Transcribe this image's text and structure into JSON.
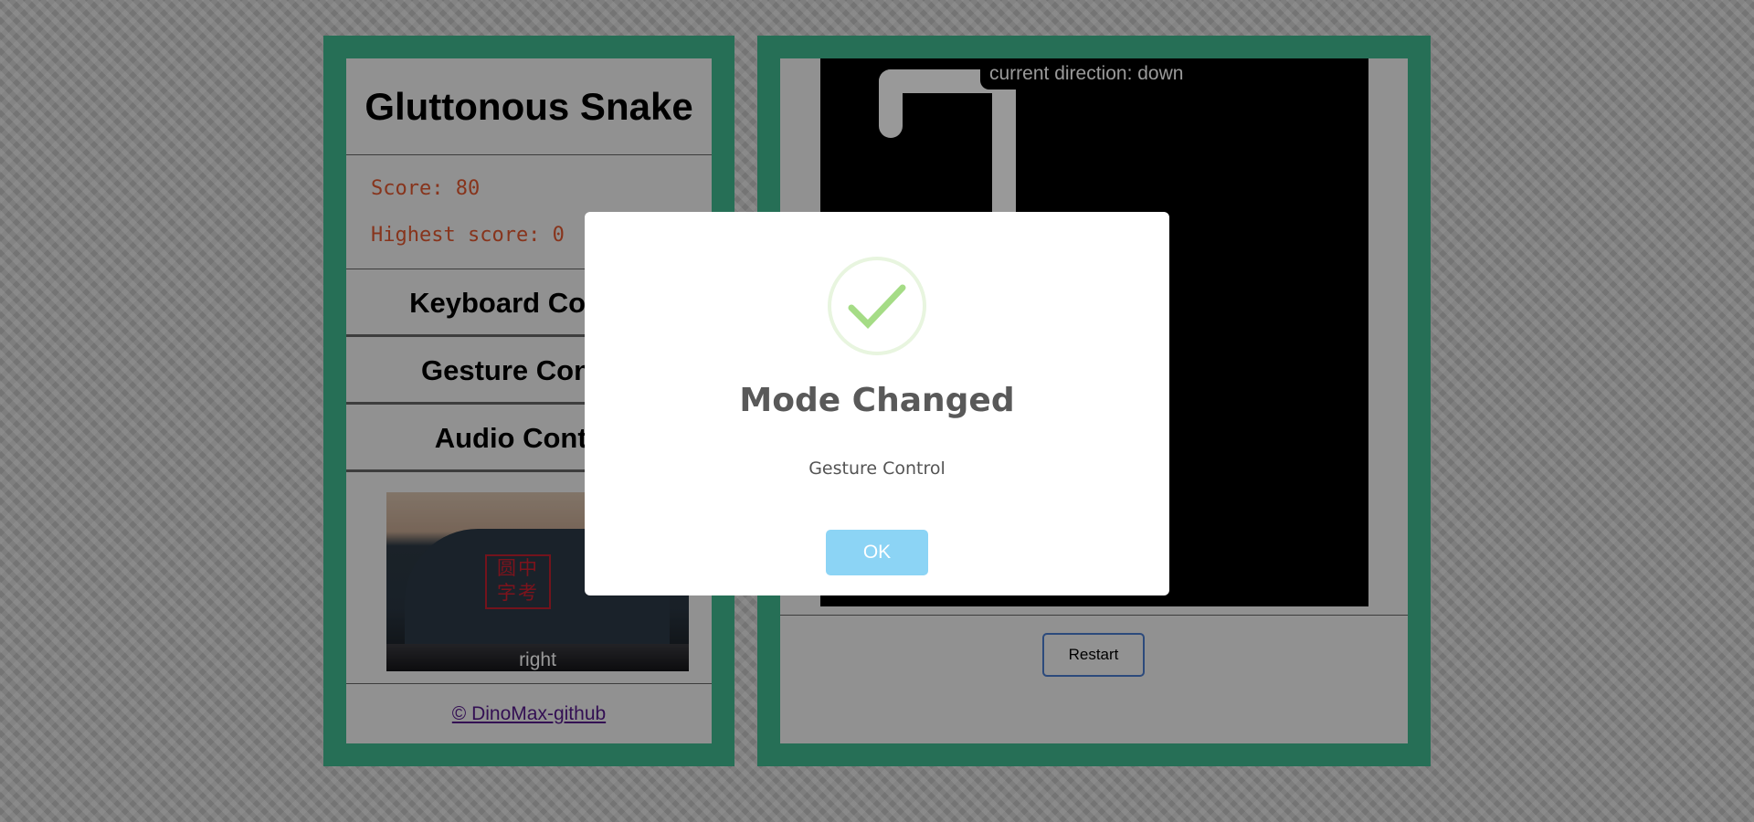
{
  "left_panel": {
    "title": "Gluttonous Snake",
    "score": "Score: 80",
    "highest_score": "Highest score: 0",
    "modes": [
      "Keyboard Control",
      "Gesture Control",
      "Audio Control"
    ],
    "camera": {
      "logo_line1": "圆中",
      "logo_line2": "字考",
      "gesture_label": "right"
    },
    "footer_link": "© DinoMax-github"
  },
  "right_panel": {
    "direction_label": "current direction: down",
    "restart_label": "Restart"
  },
  "modal": {
    "icon": "checkmark-icon",
    "title": "Mode Changed",
    "text": "Gesture Control",
    "ok_label": "OK"
  },
  "colors": {
    "panel_border": "#40b98f",
    "score_text": "#e2582f",
    "ok_button": "#8cd4f5",
    "success_green": "#a5dc86"
  }
}
